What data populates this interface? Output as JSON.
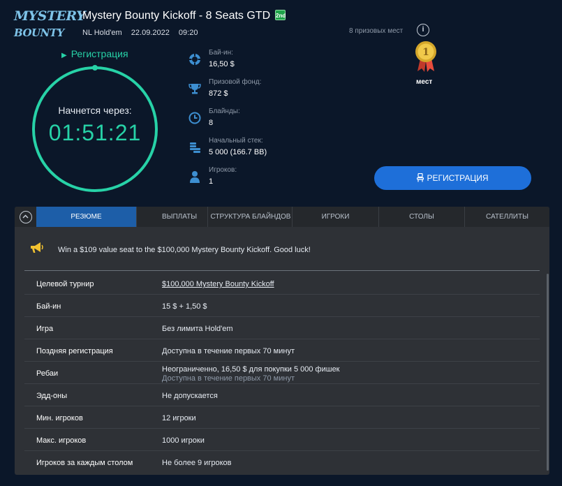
{
  "logo": {
    "line1": "MYSTERY",
    "line2": "BOUNTY"
  },
  "header": {
    "title": "Mystery Bounty Kickoff - 8 Seats GTD",
    "badge": "2nd",
    "game": "NL Hold'em",
    "date": "22.09.2022",
    "time": "09:20"
  },
  "status": {
    "registration": "Регистрация"
  },
  "timer": {
    "label": "Начнется через:",
    "value": "01:51:21"
  },
  "info": [
    {
      "label": "Бай-ин:",
      "value": "16,50 $",
      "icon": "poker-chip-icon"
    },
    {
      "label": "Призовой фонд:",
      "value": "872 $",
      "icon": "trophy-icon"
    },
    {
      "label": "Блайнды:",
      "value": "8",
      "icon": "clock-icon"
    },
    {
      "label": "Начальный стек:",
      "value": "5 000 (166.7 BB)",
      "icon": "chip-stack-icon"
    },
    {
      "label": "Игроков:",
      "value": "1",
      "icon": "player-icon"
    }
  ],
  "prizes": {
    "places_label": "8 призовых мест",
    "medal_number": "1",
    "place_word": "мест"
  },
  "register_button": {
    "label": "РЕГИСТРАЦИЯ"
  },
  "tabs": [
    {
      "label": "РЕЗЮМЕ",
      "active": true
    },
    {
      "label": "ВЫПЛАТЫ"
    },
    {
      "label": "СТРУКТУРА БЛАЙНДОВ"
    },
    {
      "label": "ИГРОКИ"
    },
    {
      "label": "СТОЛЫ"
    },
    {
      "label": "САТЕЛЛИТЫ"
    }
  ],
  "announcement": "Win a $109 value seat to the $100,000 Mystery Bounty Kickoff. Good luck!",
  "details": [
    {
      "key": "Целевой турнир",
      "value": "$100,000 Mystery Bounty Kickoff"
    },
    {
      "key": "Бай-ин",
      "value": "15 $ + 1,50 $"
    },
    {
      "key": "Игра",
      "value": "Без лимита Hold'em"
    },
    {
      "key": "Поздняя регистрация",
      "value": "Доступна в течение первых 70 минут"
    },
    {
      "key": "Ребаи",
      "value": "Неограниченно, 16,50 $ для покупки 5 000 фишек",
      "value2": "Доступна в течение первых 70 минут"
    },
    {
      "key": "Эдд-оны",
      "value": "Не допускается"
    },
    {
      "key": "Мин. игроков",
      "value": "12 игроки"
    },
    {
      "key": "Макс. игроков",
      "value": "1000 игроки"
    },
    {
      "key": "Игроков за каждым столом",
      "value": "Не более 9 игроков"
    }
  ],
  "colors": {
    "accent": "#27d2a7",
    "button": "#1e6fd9",
    "tab_active": "#1d5ea8",
    "background": "#0b1729"
  }
}
